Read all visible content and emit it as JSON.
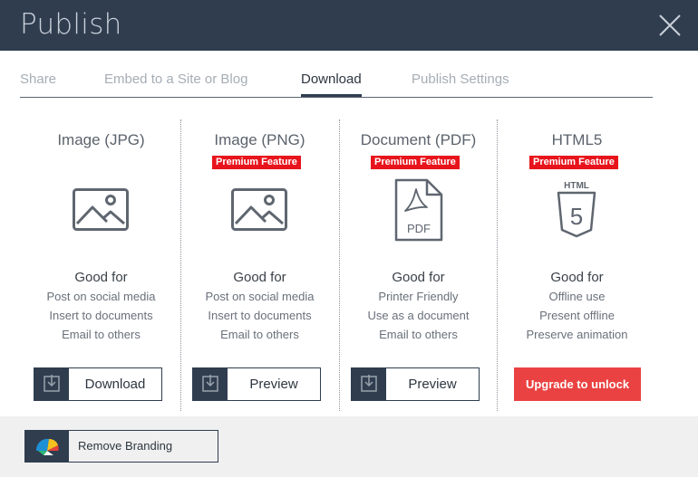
{
  "header": {
    "title": "Publish",
    "close_icon": "close-icon"
  },
  "tabs": [
    {
      "label": "Share",
      "active": false
    },
    {
      "label": "Embed to a Site or Blog",
      "active": false
    },
    {
      "label": "Download",
      "active": true
    },
    {
      "label": "Publish Settings",
      "active": false
    }
  ],
  "options": [
    {
      "title": "Image (JPG)",
      "premium": false,
      "icon": "image-icon",
      "good_for": "Good for",
      "lines": [
        "Post on social media",
        "Insert to documents",
        "Email to others"
      ],
      "button_label": "Download",
      "button_icon": "download-icon"
    },
    {
      "title": "Image (PNG)",
      "premium": true,
      "premium_label": "Premium Feature",
      "icon": "image-icon",
      "good_for": "Good for",
      "lines": [
        "Post on social media",
        "Insert to documents",
        "Email to others"
      ],
      "button_label": "Preview",
      "button_icon": "download-icon"
    },
    {
      "title": "Document (PDF)",
      "premium": true,
      "premium_label": "Premium Feature",
      "icon": "pdf-icon",
      "icon_text": "PDF",
      "good_for": "Good for",
      "lines": [
        "Printer Friendly",
        "Use as a document",
        "Email to others"
      ],
      "button_label": "Preview",
      "button_icon": "download-icon"
    },
    {
      "title": "HTML5",
      "premium": true,
      "premium_label": "Premium Feature",
      "icon": "html5-icon",
      "icon_text": "HTML",
      "icon_number": "5",
      "good_for": "Good for",
      "lines": [
        "Offline use",
        "Present offline",
        "Preserve animation"
      ],
      "button_label": "Upgrade to unlock"
    }
  ],
  "footer": {
    "branding_label": "Remove Branding",
    "branding_icon": "brand-logo-icon"
  },
  "colors": {
    "header_bg": "#2f3d4f",
    "premium_red": "#e8141c",
    "upgrade_red": "#ea4242",
    "footer_bg": "#f0f0f0"
  }
}
